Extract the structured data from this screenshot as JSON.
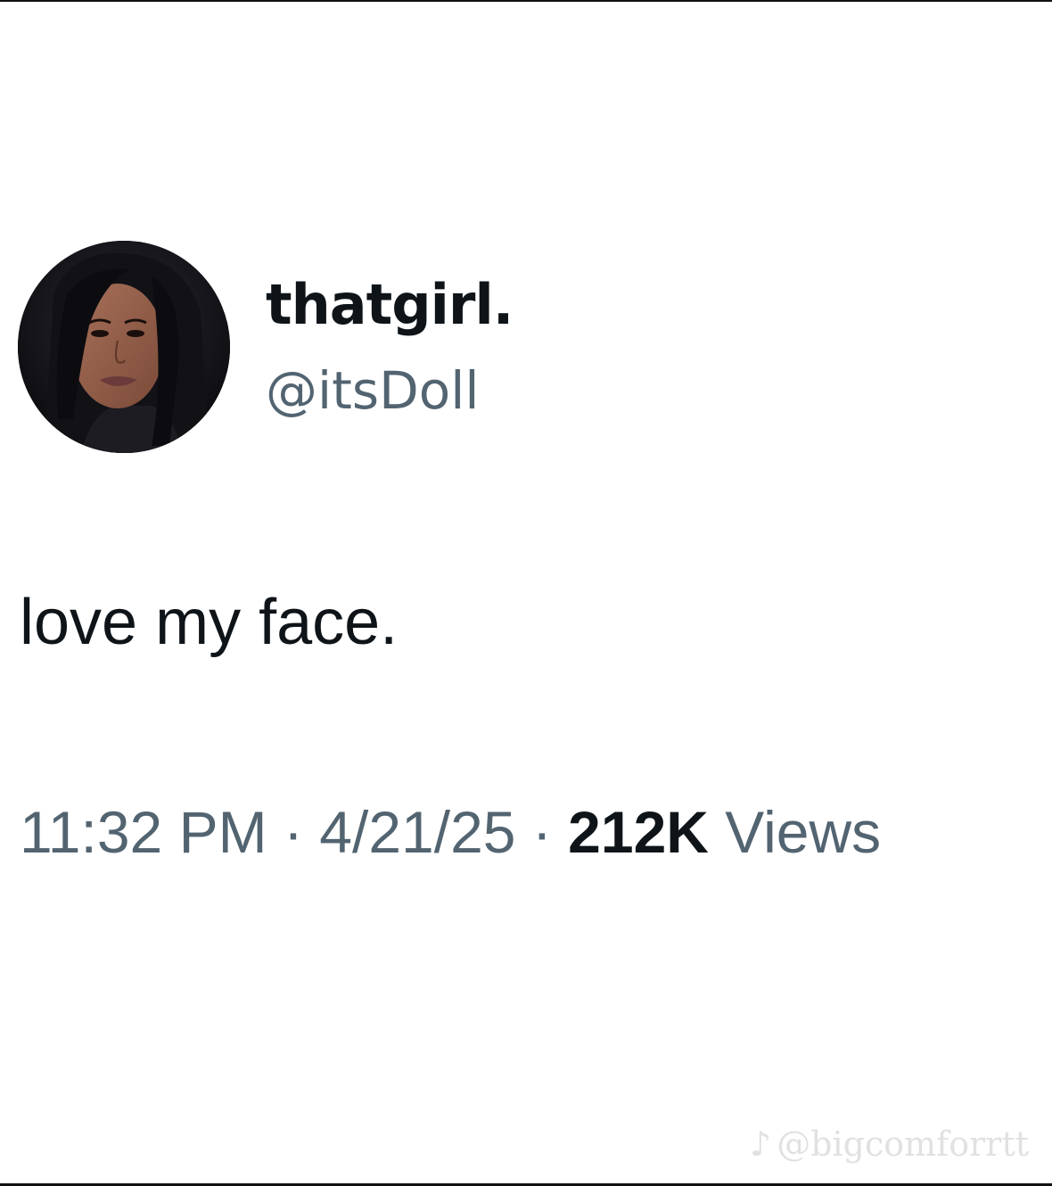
{
  "tweet": {
    "author": {
      "display_name": "thatgirl.",
      "handle": "@itsDoll",
      "avatar_icon": "profile-photo"
    },
    "text": "love my face.",
    "meta": {
      "time": "11:32 PM",
      "separator": "·",
      "date": "4/21/25",
      "views_count": "212K",
      "views_label": "Views"
    }
  },
  "watermark": {
    "icon": "tiktok-icon",
    "glyph": "♪",
    "text": "@bigcomforrtt"
  },
  "colors": {
    "primary_text": "#0f1419",
    "secondary_text": "#536471",
    "background": "#ffffff"
  }
}
